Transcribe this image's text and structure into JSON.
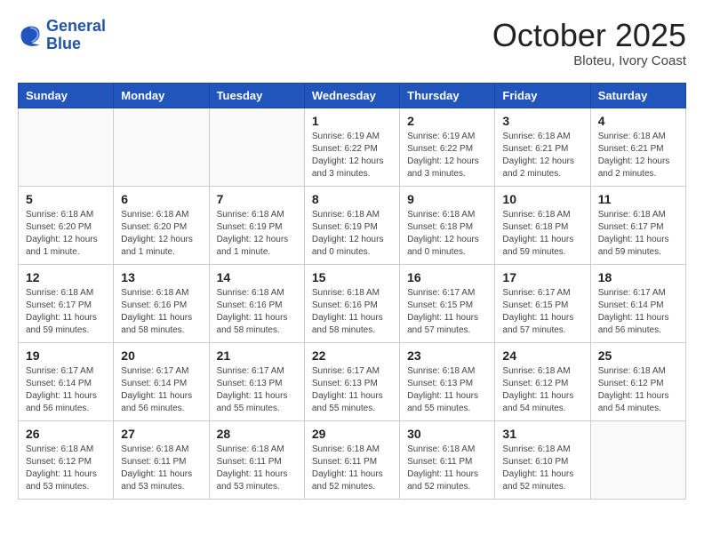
{
  "header": {
    "logo_line1": "General",
    "logo_line2": "Blue",
    "month_title": "October 2025",
    "location": "Bloteu, Ivory Coast"
  },
  "days_of_week": [
    "Sunday",
    "Monday",
    "Tuesday",
    "Wednesday",
    "Thursday",
    "Friday",
    "Saturday"
  ],
  "weeks": [
    [
      {
        "day": "",
        "info": ""
      },
      {
        "day": "",
        "info": ""
      },
      {
        "day": "",
        "info": ""
      },
      {
        "day": "1",
        "info": "Sunrise: 6:19 AM\nSunset: 6:22 PM\nDaylight: 12 hours\nand 3 minutes."
      },
      {
        "day": "2",
        "info": "Sunrise: 6:19 AM\nSunset: 6:22 PM\nDaylight: 12 hours\nand 3 minutes."
      },
      {
        "day": "3",
        "info": "Sunrise: 6:18 AM\nSunset: 6:21 PM\nDaylight: 12 hours\nand 2 minutes."
      },
      {
        "day": "4",
        "info": "Sunrise: 6:18 AM\nSunset: 6:21 PM\nDaylight: 12 hours\nand 2 minutes."
      }
    ],
    [
      {
        "day": "5",
        "info": "Sunrise: 6:18 AM\nSunset: 6:20 PM\nDaylight: 12 hours\nand 1 minute."
      },
      {
        "day": "6",
        "info": "Sunrise: 6:18 AM\nSunset: 6:20 PM\nDaylight: 12 hours\nand 1 minute."
      },
      {
        "day": "7",
        "info": "Sunrise: 6:18 AM\nSunset: 6:19 PM\nDaylight: 12 hours\nand 1 minute."
      },
      {
        "day": "8",
        "info": "Sunrise: 6:18 AM\nSunset: 6:19 PM\nDaylight: 12 hours\nand 0 minutes."
      },
      {
        "day": "9",
        "info": "Sunrise: 6:18 AM\nSunset: 6:18 PM\nDaylight: 12 hours\nand 0 minutes."
      },
      {
        "day": "10",
        "info": "Sunrise: 6:18 AM\nSunset: 6:18 PM\nDaylight: 11 hours\nand 59 minutes."
      },
      {
        "day": "11",
        "info": "Sunrise: 6:18 AM\nSunset: 6:17 PM\nDaylight: 11 hours\nand 59 minutes."
      }
    ],
    [
      {
        "day": "12",
        "info": "Sunrise: 6:18 AM\nSunset: 6:17 PM\nDaylight: 11 hours\nand 59 minutes."
      },
      {
        "day": "13",
        "info": "Sunrise: 6:18 AM\nSunset: 6:16 PM\nDaylight: 11 hours\nand 58 minutes."
      },
      {
        "day": "14",
        "info": "Sunrise: 6:18 AM\nSunset: 6:16 PM\nDaylight: 11 hours\nand 58 minutes."
      },
      {
        "day": "15",
        "info": "Sunrise: 6:18 AM\nSunset: 6:16 PM\nDaylight: 11 hours\nand 58 minutes."
      },
      {
        "day": "16",
        "info": "Sunrise: 6:17 AM\nSunset: 6:15 PM\nDaylight: 11 hours\nand 57 minutes."
      },
      {
        "day": "17",
        "info": "Sunrise: 6:17 AM\nSunset: 6:15 PM\nDaylight: 11 hours\nand 57 minutes."
      },
      {
        "day": "18",
        "info": "Sunrise: 6:17 AM\nSunset: 6:14 PM\nDaylight: 11 hours\nand 56 minutes."
      }
    ],
    [
      {
        "day": "19",
        "info": "Sunrise: 6:17 AM\nSunset: 6:14 PM\nDaylight: 11 hours\nand 56 minutes."
      },
      {
        "day": "20",
        "info": "Sunrise: 6:17 AM\nSunset: 6:14 PM\nDaylight: 11 hours\nand 56 minutes."
      },
      {
        "day": "21",
        "info": "Sunrise: 6:17 AM\nSunset: 6:13 PM\nDaylight: 11 hours\nand 55 minutes."
      },
      {
        "day": "22",
        "info": "Sunrise: 6:17 AM\nSunset: 6:13 PM\nDaylight: 11 hours\nand 55 minutes."
      },
      {
        "day": "23",
        "info": "Sunrise: 6:18 AM\nSunset: 6:13 PM\nDaylight: 11 hours\nand 55 minutes."
      },
      {
        "day": "24",
        "info": "Sunrise: 6:18 AM\nSunset: 6:12 PM\nDaylight: 11 hours\nand 54 minutes."
      },
      {
        "day": "25",
        "info": "Sunrise: 6:18 AM\nSunset: 6:12 PM\nDaylight: 11 hours\nand 54 minutes."
      }
    ],
    [
      {
        "day": "26",
        "info": "Sunrise: 6:18 AM\nSunset: 6:12 PM\nDaylight: 11 hours\nand 53 minutes."
      },
      {
        "day": "27",
        "info": "Sunrise: 6:18 AM\nSunset: 6:11 PM\nDaylight: 11 hours\nand 53 minutes."
      },
      {
        "day": "28",
        "info": "Sunrise: 6:18 AM\nSunset: 6:11 PM\nDaylight: 11 hours\nand 53 minutes."
      },
      {
        "day": "29",
        "info": "Sunrise: 6:18 AM\nSunset: 6:11 PM\nDaylight: 11 hours\nand 52 minutes."
      },
      {
        "day": "30",
        "info": "Sunrise: 6:18 AM\nSunset: 6:11 PM\nDaylight: 11 hours\nand 52 minutes."
      },
      {
        "day": "31",
        "info": "Sunrise: 6:18 AM\nSunset: 6:10 PM\nDaylight: 11 hours\nand 52 minutes."
      },
      {
        "day": "",
        "info": ""
      }
    ]
  ]
}
